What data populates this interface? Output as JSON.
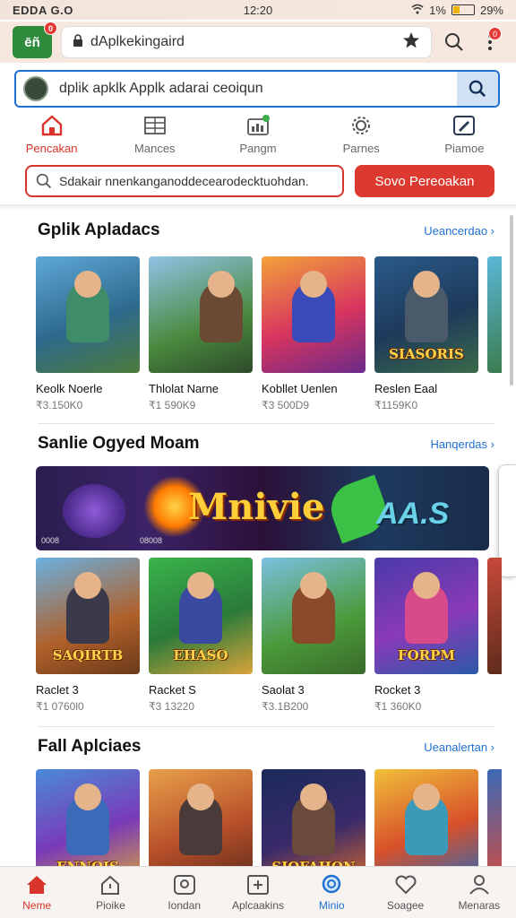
{
  "status_bar": {
    "left": "EDDA G.O",
    "time": "12:20",
    "battery_text": "29%",
    "signal_text": "1%",
    "battery_level": 0.29
  },
  "address_bar": {
    "logo_text": "ēñ",
    "logo_badge": "0",
    "url": "dAplkekingaird",
    "menu_badge": "0"
  },
  "search": {
    "value": "dplik apklk Applk adarai ceoiqun"
  },
  "category_tabs": [
    {
      "label": "Pencakan",
      "icon": "home-icon",
      "active": true
    },
    {
      "label": "Mances",
      "icon": "grid-list-icon",
      "active": false
    },
    {
      "label": "Pangm",
      "icon": "chart-icon",
      "active": false
    },
    {
      "label": "Parnes",
      "icon": "gear-icon",
      "active": false
    },
    {
      "label": "Piamoe",
      "icon": "edit-icon",
      "active": false
    }
  ],
  "filter": {
    "value": "Sdakair nnenkanganoddecearodecktuohdan.",
    "button": "Sovo Pereoakan"
  },
  "sections": [
    {
      "title": "Gplik Apladacs",
      "see_more": "Ueancerdao",
      "items": [
        {
          "name": "Keolk Noerle",
          "size": "₹3.150K0",
          "brand": ""
        },
        {
          "name": "Thlolat Narne",
          "size": "₹1 590K9",
          "brand": ""
        },
        {
          "name": "Kobllet Uenlen",
          "size": "₹3 500D9",
          "brand": ""
        },
        {
          "name": "Reslen Eaal",
          "size": "₹1159K0",
          "brand": "SIASORIS"
        }
      ]
    },
    {
      "title": "Sanlie Ogyed Moam",
      "see_more": "Hanqerdas",
      "banner": {
        "title_a": "Mnivie",
        "title_b": "AA.S",
        "foot_left": "0008",
        "foot_mid": "08008"
      },
      "items": [
        {
          "name": "Raclet 3",
          "size": "₹1 0760l0",
          "brand": "SAQIRTB"
        },
        {
          "name": "Racket S",
          "size": "₹3 13220",
          "brand": "EHASO"
        },
        {
          "name": "Saolat 3",
          "size": "₹3.1B200",
          "brand": ""
        },
        {
          "name": "Rocket 3",
          "size": "₹1 360K0",
          "brand": "FORPM"
        }
      ]
    },
    {
      "title": "Fall Aplciaes",
      "see_more": "Ueanalertan",
      "items": [
        {
          "name": "",
          "size": "",
          "brand": "ENNOIS"
        },
        {
          "name": "",
          "size": "",
          "brand": ""
        },
        {
          "name": "",
          "size": "",
          "brand": "SIOFAHON"
        },
        {
          "name": "",
          "size": "",
          "brand": ""
        }
      ]
    }
  ],
  "bottom_nav": [
    {
      "label": "Neme",
      "icon": "home-icon",
      "state": "active"
    },
    {
      "label": "Pioike",
      "icon": "house-outline-icon",
      "state": ""
    },
    {
      "label": "Iondan",
      "icon": "search-icon",
      "state": ""
    },
    {
      "label": "Aplcaakins",
      "icon": "apps-icon",
      "state": ""
    },
    {
      "label": "Minio",
      "icon": "chat-icon",
      "state": "blue"
    },
    {
      "label": "Soagee",
      "icon": "heart-icon",
      "state": ""
    },
    {
      "label": "Menaras",
      "icon": "user-icon",
      "state": ""
    }
  ],
  "colors": {
    "accent_red": "#d9342b",
    "accent_blue": "#1f6fd1",
    "brand_green": "#2e8b3b"
  }
}
